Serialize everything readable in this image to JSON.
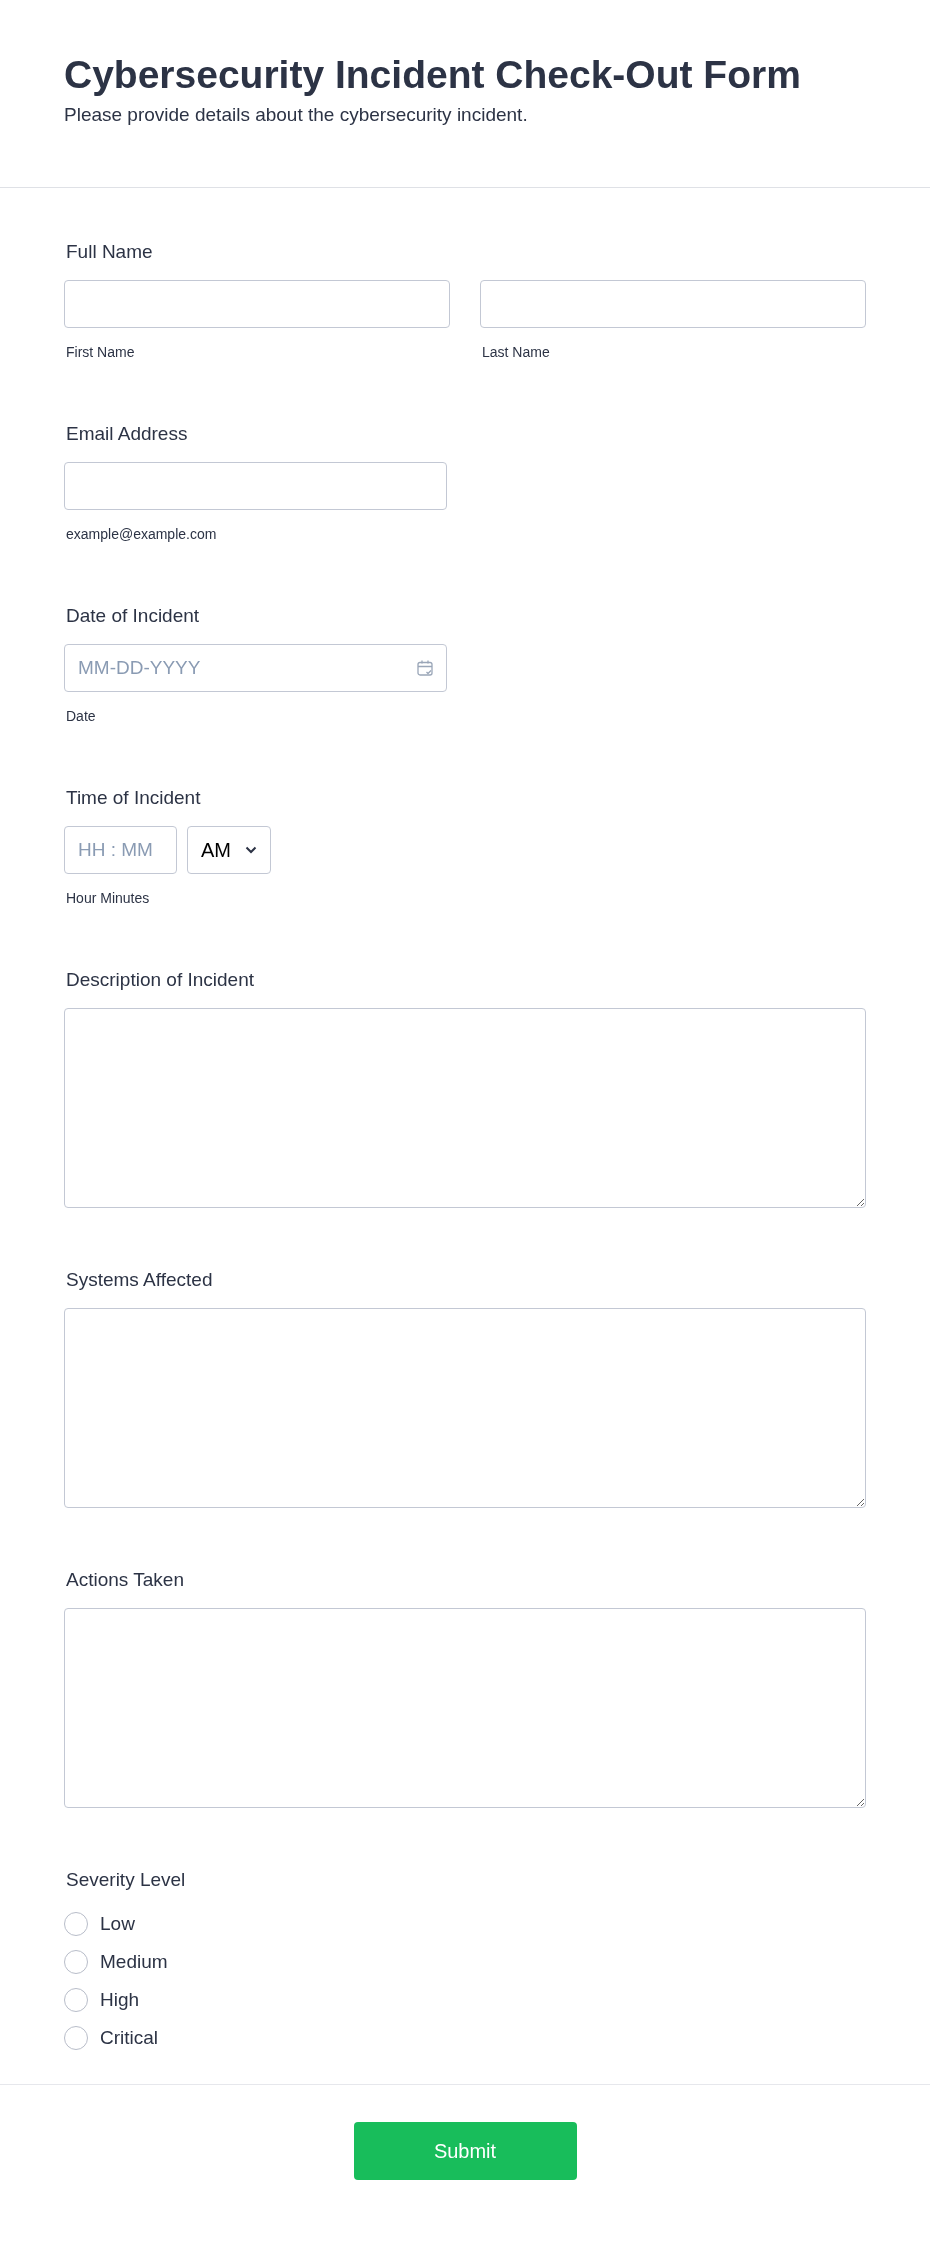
{
  "header": {
    "title": "Cybersecurity Incident Check-Out Form",
    "subtitle": "Please provide details about the cybersecurity incident."
  },
  "fields": [
    {
      "kind": "name",
      "label": "Full Name",
      "parts": [
        {
          "sublabel": "First Name"
        },
        {
          "sublabel": "Last Name"
        }
      ]
    },
    {
      "kind": "email",
      "label": "Email Address",
      "sublabel": "example@example.com"
    },
    {
      "kind": "date",
      "label": "Date of Incident",
      "placeholder": "MM-DD-YYYY",
      "sublabel": "Date"
    },
    {
      "kind": "time",
      "label": "Time of Incident",
      "placeholder": "HH : MM",
      "period": "AM",
      "sublabel": "Hour Minutes"
    },
    {
      "kind": "textarea",
      "label": "Description of Incident"
    },
    {
      "kind": "textarea",
      "label": "Systems Affected"
    },
    {
      "kind": "textarea",
      "label": "Actions Taken"
    },
    {
      "kind": "radio",
      "label": "Severity Level",
      "options": [
        {
          "label": "Low",
          "selected": false
        },
        {
          "label": "Medium",
          "selected": false
        },
        {
          "label": "High",
          "selected": false
        },
        {
          "label": "Critical",
          "selected": false
        }
      ]
    }
  ],
  "submit": {
    "label": "Submit"
  }
}
